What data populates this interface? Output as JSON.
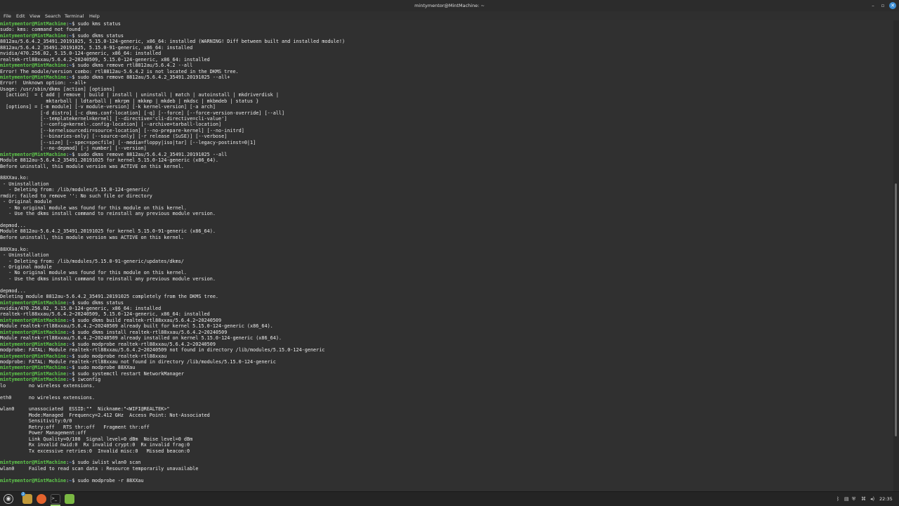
{
  "window": {
    "title": "mintymentor@MintMachine: ~",
    "controls": {
      "minimize": "–",
      "maximize": "▫",
      "close": "✕"
    }
  },
  "menubar": [
    "File",
    "Edit",
    "View",
    "Search",
    "Terminal",
    "Help"
  ],
  "prompt": {
    "user": "mintymentor@MintMachine",
    "path": "~",
    "symbol": "$"
  },
  "terminal_lines": [
    {
      "type": "cmd",
      "text": "sudo kms status"
    },
    {
      "type": "out",
      "text": "sudo: kms: command not found"
    },
    {
      "type": "cmd",
      "text": "sudo dkms status"
    },
    {
      "type": "out",
      "text": "8812au/5.6.4.2_35491.20191025, 5.15.0-124-generic, x86_64: installed (WARNING! Diff between built and installed module!)"
    },
    {
      "type": "out",
      "text": "8812au/5.6.4.2_35491.20191025, 5.15.0-91-generic, x86_64: installed"
    },
    {
      "type": "out",
      "text": "nvidia/470.256.02, 5.15.0-124-generic, x86_64: installed"
    },
    {
      "type": "out",
      "text": "realtek-rtl88xxau/5.6.4.2~20240509, 5.15.0-124-generic, x86_64: installed"
    },
    {
      "type": "cmd",
      "text": "sudo dkms remove rtl8812au/5.6.4.2 --all"
    },
    {
      "type": "out",
      "text": "Error! The module/version combo: rtl8812au-5.6.4.2 is not located in the DKMS tree."
    },
    {
      "type": "cmd",
      "text": "sudo dkms remove 8812au/5.6.4.2_35491.20191025 --all+"
    },
    {
      "type": "out",
      "text": "Error!  Unknown option: --all+"
    },
    {
      "type": "out",
      "text": "Usage: /usr/sbin/dkms [action] [options]"
    },
    {
      "type": "out",
      "text": "  [action]  = { add | remove | build | install | uninstall | match | autoinstall | mkdriverdisk |"
    },
    {
      "type": "out",
      "text": "                mktarball | ldtarball | mkrpm | mkkmp | mkdeb | mkdsc | mkbmdeb | status }"
    },
    {
      "type": "out",
      "text": "  [options] = [-m module] [-v module-version] [-k kernel-version] [-a arch]"
    },
    {
      "type": "out",
      "text": "              [-d distro] [-c dkms.conf-location] [-q] [--force] [--force-version-override] [--all]"
    },
    {
      "type": "out",
      "text": "              [--templatekernel=kernel] [--directive='cli-directive=cli-value']"
    },
    {
      "type": "out",
      "text": "              [--config=kernel-.config-location] [--archive=tarball-location]"
    },
    {
      "type": "out",
      "text": "              [--kernelsourcedir=source-location] [--no-prepare-kernel] [--no-initrd]"
    },
    {
      "type": "out",
      "text": "              [--binaries-only] [--source-only] [-r release (SuSE)] [--verbose]"
    },
    {
      "type": "out",
      "text": "              [--size] [--spec=specfile] [--media=floppy|iso|tar] [--legacy-postinst=0|1]"
    },
    {
      "type": "out",
      "text": "              [--no-depmod] [-j number] [--version]"
    },
    {
      "type": "cmd",
      "text": "sudo dkms remove 8812au/5.6.4.2_35491.20191025 --all"
    },
    {
      "type": "out",
      "text": "Module 8812au-5.6.4.2_35491.20191025 for kernel 5.15.0-124-generic (x86_64)."
    },
    {
      "type": "out",
      "text": "Before uninstall, this module version was ACTIVE on this kernel."
    },
    {
      "type": "out",
      "text": ""
    },
    {
      "type": "out",
      "text": "88XXau.ko:"
    },
    {
      "type": "out",
      "text": " - Uninstallation"
    },
    {
      "type": "out",
      "text": "   - Deleting from: /lib/modules/5.15.0-124-generic/"
    },
    {
      "type": "out",
      "text": "rmdir: failed to remove '': No such file or directory"
    },
    {
      "type": "out",
      "text": " - Original module"
    },
    {
      "type": "out",
      "text": "   - No original module was found for this module on this kernel."
    },
    {
      "type": "out",
      "text": "   - Use the dkms install command to reinstall any previous module version."
    },
    {
      "type": "out",
      "text": ""
    },
    {
      "type": "out",
      "text": "depmod..."
    },
    {
      "type": "out",
      "text": "Module 8812au-5.6.4.2_35491.20191025 for kernel 5.15.0-91-generic (x86_64)."
    },
    {
      "type": "out",
      "text": "Before uninstall, this module version was ACTIVE on this kernel."
    },
    {
      "type": "out",
      "text": ""
    },
    {
      "type": "out",
      "text": "88XXau.ko:"
    },
    {
      "type": "out",
      "text": " - Uninstallation"
    },
    {
      "type": "out",
      "text": "   - Deleting from: /lib/modules/5.15.0-91-generic/updates/dkms/"
    },
    {
      "type": "out",
      "text": " - Original module"
    },
    {
      "type": "out",
      "text": "   - No original module was found for this module on this kernel."
    },
    {
      "type": "out",
      "text": "   - Use the dkms install command to reinstall any previous module version."
    },
    {
      "type": "out",
      "text": ""
    },
    {
      "type": "out",
      "text": "depmod..."
    },
    {
      "type": "out",
      "text": "Deleting module 8812au-5.6.4.2_35491.20191025 completely from the DKMS tree."
    },
    {
      "type": "cmd",
      "text": "sudo dkms status"
    },
    {
      "type": "out",
      "text": "nvidia/470.256.02, 5.15.0-124-generic, x86_64: installed"
    },
    {
      "type": "out",
      "text": "realtek-rtl88xxau/5.6.4.2~20240509, 5.15.0-124-generic, x86_64: installed"
    },
    {
      "type": "cmd",
      "text": "sudo dkms build realtek-rtl88xxau/5.6.4.2~20240509"
    },
    {
      "type": "out",
      "text": "Module realtek-rtl88xxau/5.6.4.2~20240509 already built for kernel 5.15.0-124-generic (x86_64)."
    },
    {
      "type": "cmd",
      "text": "sudo dkms install realtek-rtl88xxau/5.6.4.2~20240509"
    },
    {
      "type": "out",
      "text": "Module realtek-rtl88xxau/5.6.4.2~20240509 already installed on kernel 5.15.0-124-generic (x86_64)."
    },
    {
      "type": "cmd",
      "text": "sudo modprobe realtek-rtl88xxau/5.6.4.2~20240509"
    },
    {
      "type": "out",
      "text": "modprobe: FATAL: Module realtek-rtl88xxau/5.6.4.2~20240509 not found in directory /lib/modules/5.15.0-124-generic"
    },
    {
      "type": "cmd",
      "text": "sudo modprobe realtek-rtl88xxau"
    },
    {
      "type": "out",
      "text": "modprobe: FATAL: Module realtek-rtl88xxau not found in directory /lib/modules/5.15.0-124-generic"
    },
    {
      "type": "cmd",
      "text": "sudo modprobe 88XXau"
    },
    {
      "type": "cmd",
      "text": "sudo systemctl restart NetworkManager"
    },
    {
      "type": "cmd",
      "text": "iwconfig"
    },
    {
      "type": "out",
      "text": "lo        no wireless extensions."
    },
    {
      "type": "out",
      "text": ""
    },
    {
      "type": "out",
      "text": "eth0      no wireless extensions."
    },
    {
      "type": "out",
      "text": ""
    },
    {
      "type": "out",
      "text": "wlan0     unassociated  ESSID:\"\"  Nickname:\"<WIFI@REALTEK>\""
    },
    {
      "type": "out",
      "text": "          Mode:Managed  Frequency=2.412 GHz  Access Point: Not-Associated"
    },
    {
      "type": "out",
      "text": "          Sensitivity:0/0"
    },
    {
      "type": "out",
      "text": "          Retry:off   RTS thr:off   Fragment thr:off"
    },
    {
      "type": "out",
      "text": "          Power Management:off"
    },
    {
      "type": "out",
      "text": "          Link Quality=0/100  Signal level=0 dBm  Noise level=0 dBm"
    },
    {
      "type": "out",
      "text": "          Rx invalid nwid:0  Rx invalid crypt:0  Rx invalid frag:0"
    },
    {
      "type": "out",
      "text": "          Tx excessive retries:0  Invalid misc:0   Missed beacon:0"
    },
    {
      "type": "out",
      "text": ""
    },
    {
      "type": "cmd",
      "text": "sudo iwlist wlan0 scan"
    },
    {
      "type": "out",
      "text": "wlan0     Failed to read scan data : Resource temporarily unavailable"
    },
    {
      "type": "out",
      "text": ""
    },
    {
      "type": "cmd",
      "text": "sudo modprobe -r 88XXau"
    }
  ],
  "taskbar": {
    "files_badge": "2",
    "clock": "22:35",
    "tray_icons": [
      "bluetooth-icon",
      "clipboard-icon",
      "shield-icon",
      "network-icon",
      "volume-icon",
      "battery-icon"
    ]
  },
  "colors": {
    "prompt_user": "#5fc94c",
    "prompt_path": "#4d8cf0",
    "terminal_bg": "#303030",
    "text": "#ececec"
  }
}
